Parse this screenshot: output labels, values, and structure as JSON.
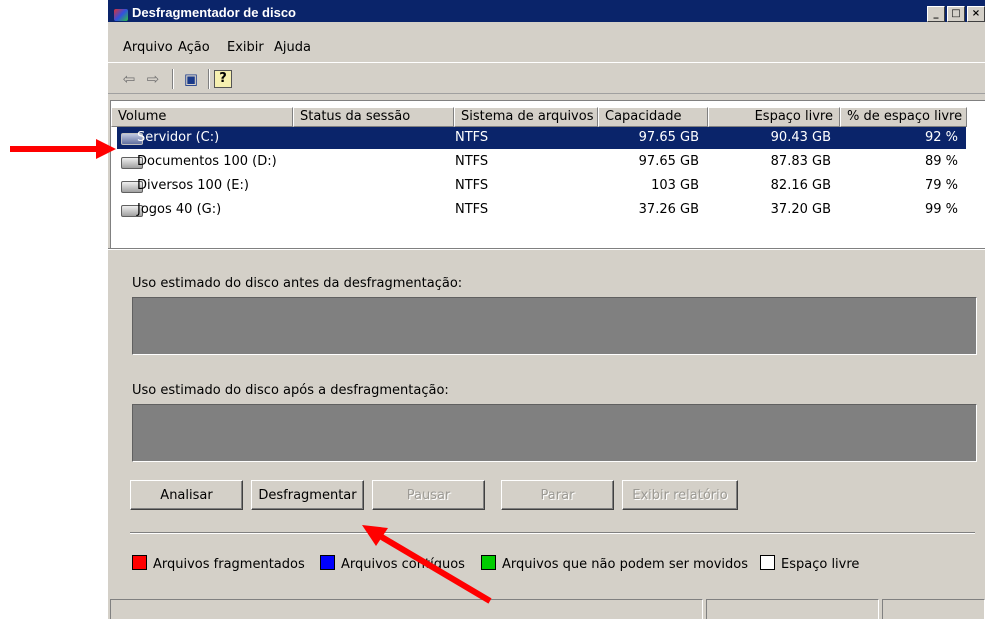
{
  "window": {
    "title": "Desfragmentador de disco",
    "controls": [
      "_",
      "□",
      "×"
    ]
  },
  "menu": [
    "Arquivo",
    "Ação",
    "Exibir",
    "Ajuda"
  ],
  "toolbar": {
    "icons": [
      "back-arrow-icon",
      "forward-arrow-icon",
      "console-tree-icon",
      "help-icon"
    ],
    "back_glyph": "⇦",
    "forward_glyph": "⇨",
    "tree_glyph": "▣",
    "help_glyph": "?"
  },
  "table": {
    "columns": [
      "Volume",
      "Status da sessão",
      "Sistema de arquivos",
      "Capacidade",
      "Espaço livre",
      "% de espaço livre"
    ],
    "rows": [
      {
        "volume": "Servidor (C:)",
        "status": "",
        "fs": "NTFS",
        "capacity": "97.65 GB",
        "free": "90.43 GB",
        "pct": "92 %",
        "selected": true
      },
      {
        "volume": "Documentos 100 (D:)",
        "status": "",
        "fs": "NTFS",
        "capacity": "97.65 GB",
        "free": "87.83 GB",
        "pct": "89 %",
        "selected": false
      },
      {
        "volume": "Diversos 100 (E:)",
        "status": "",
        "fs": "NTFS",
        "capacity": "103 GB",
        "free": "82.16 GB",
        "pct": "79 %",
        "selected": false
      },
      {
        "volume": "Jogos 40 (G:)",
        "status": "",
        "fs": "NTFS",
        "capacity": "37.26 GB",
        "free": "37.20 GB",
        "pct": "99 %",
        "selected": false
      }
    ]
  },
  "usage": {
    "before_label": "Uso estimado do disco antes da desfragmentação:",
    "after_label": "Uso estimado do disco após a desfragmentação:"
  },
  "buttons": {
    "analyze": "Analisar",
    "defrag": "Desfragmentar",
    "pause": "Pausar",
    "stop": "Parar",
    "report": "Exibir relatório"
  },
  "legend": {
    "fragmented": "Arquivos fragmentados",
    "contiguous": "Arquivos contíguos",
    "unmovable": "Arquivos que não podem ser movidos",
    "free": "Espaço livre"
  },
  "colors": {
    "fragmented": "#ff0000",
    "contiguous": "#0000ff",
    "unmovable": "#00cc00",
    "free": "#ffffff",
    "annotation_arrow": "#ff0000",
    "selection": "#0a246a"
  }
}
